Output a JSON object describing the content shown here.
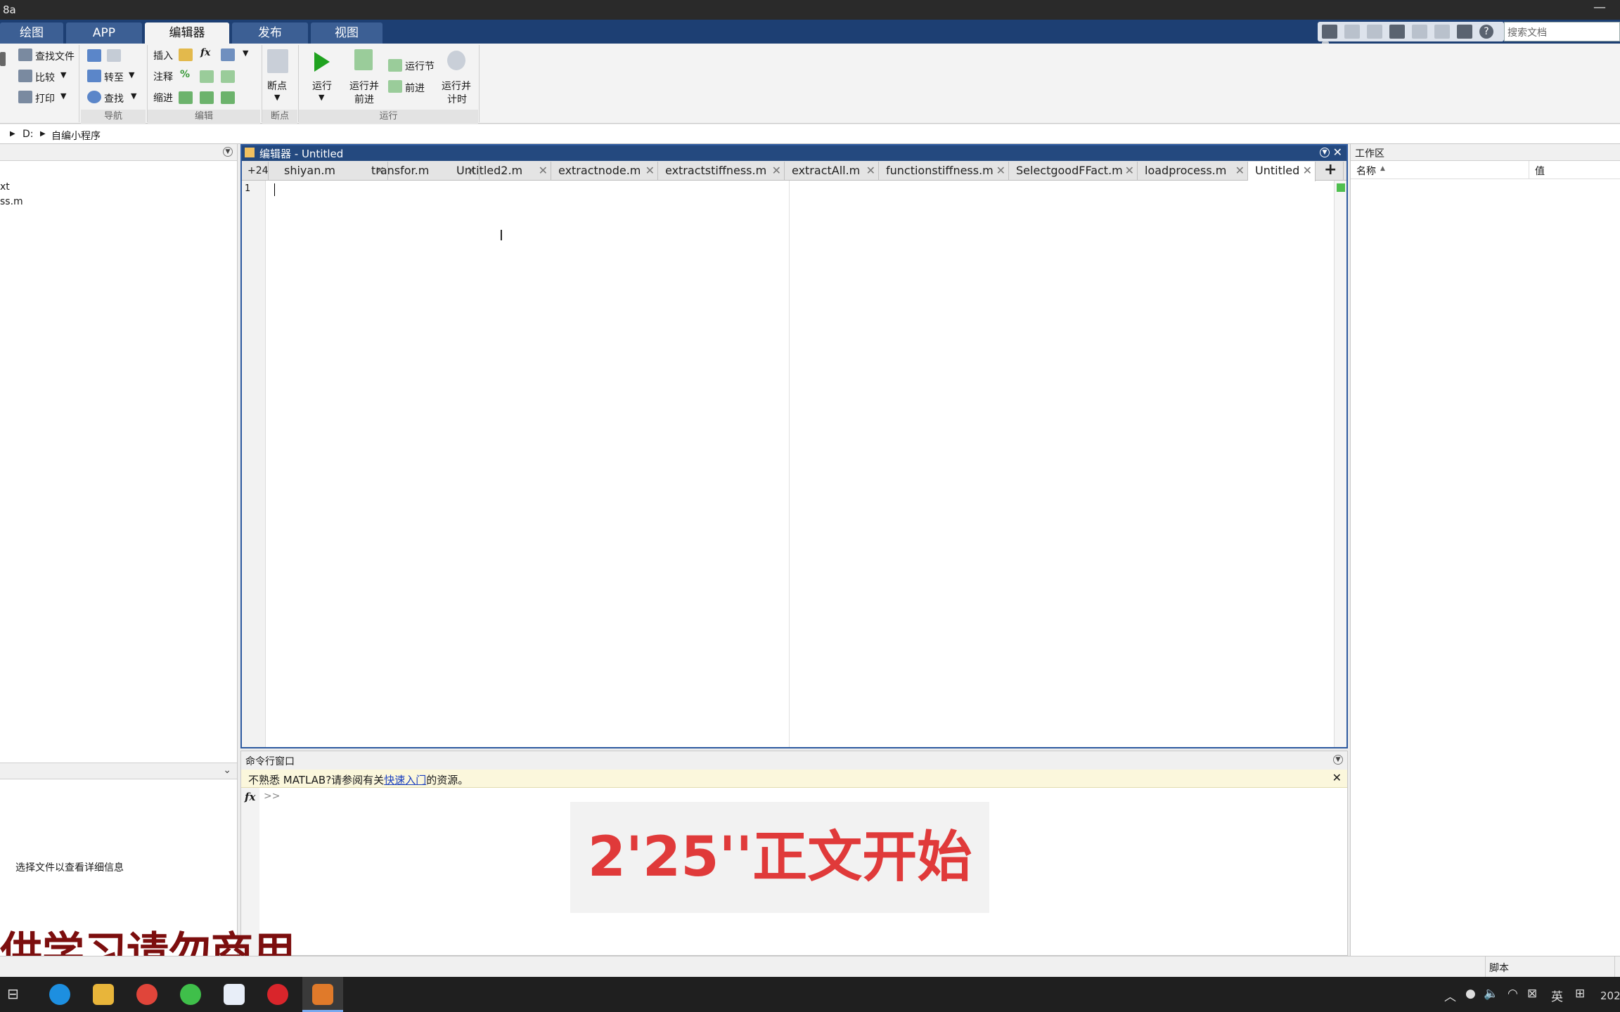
{
  "window": {
    "title": "8a",
    "minimize": "—"
  },
  "toolstrip_tabs": [
    "绘图",
    "APP",
    "编辑器",
    "发布",
    "视图"
  ],
  "search_docs_placeholder": "搜索文档",
  "ribbon": {
    "file": {
      "find_files": "查找文件",
      "compare": "比较",
      "print": "打印"
    },
    "navigate": {
      "goto": "转至",
      "find": "查找",
      "group": "导航"
    },
    "edit": {
      "insert": "插入",
      "comment": "注释",
      "indent": "缩进",
      "group": "编辑",
      "fx": "fx"
    },
    "breakpoints": {
      "label": "断点",
      "group": "断点"
    },
    "run": {
      "run": "运行",
      "run_advance_1": "运行并",
      "run_advance_2": "前进",
      "run_section": "运行节",
      "advance": "前进",
      "run_time_1": "运行并",
      "run_time_2": "计时",
      "group": "运行"
    }
  },
  "address": {
    "drive": "D:",
    "folder": "自编小程序"
  },
  "left_panel": {
    "files": [
      "xt",
      "ss.m"
    ],
    "details_hint": "选择文件以查看详细信息"
  },
  "editor": {
    "title": "编辑器 - Untitled",
    "overflow_count": "+24",
    "tabs": [
      "shiyan.m",
      "transfor.m",
      "Untitled2.m",
      "extractnode.m",
      "extractstiffness.m",
      "extractAll.m",
      "functionstiffness.m",
      "SelectgoodFFact.m",
      "loadprocess.m",
      "Untitled"
    ],
    "active_tab": "Untitled",
    "line_number": "1",
    "add_tab": "+"
  },
  "command_window": {
    "title": "命令行窗口",
    "notice_prefix": "不熟悉 MATLAB?请参阅有关",
    "notice_link": "快速入门",
    "notice_suffix": "的资源。",
    "fx": "fx",
    "prompt": ">>"
  },
  "workspace": {
    "title": "工作区",
    "col_name": "名称",
    "col_value": "值"
  },
  "overlays": {
    "timestamp": "2'25''正文开始",
    "watermark": "供学习请勿商用"
  },
  "status": {
    "mode": "脚本"
  },
  "taskbar": {
    "ime": "英",
    "clock": "202"
  },
  "colors": {
    "tab_bar": "#1d3f73",
    "editor_header": "#24497f",
    "run_green": "#1fa21f",
    "overlay_red": "#e03a3a",
    "watermark": "#7c0e0e"
  }
}
